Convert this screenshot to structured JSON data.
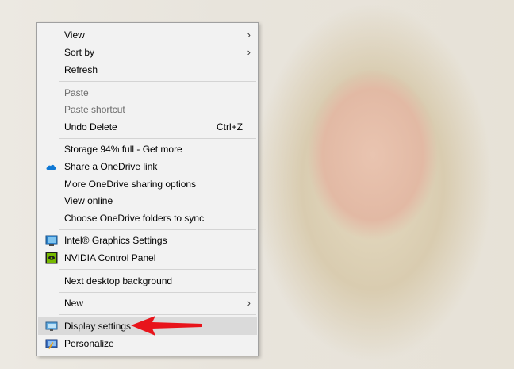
{
  "menu": {
    "view": "View",
    "sort_by": "Sort by",
    "refresh": "Refresh",
    "paste": "Paste",
    "paste_shortcut": "Paste shortcut",
    "undo_delete": "Undo Delete",
    "undo_shortcut": "Ctrl+Z",
    "storage": "Storage 94% full - Get more",
    "share_onedrive": "Share a OneDrive link",
    "more_sharing": "More OneDrive sharing options",
    "view_online": "View online",
    "choose_folders": "Choose OneDrive folders to sync",
    "intel_graphics": "Intel® Graphics Settings",
    "nvidia": "NVIDIA Control Panel",
    "next_background": "Next desktop background",
    "new": "New",
    "display_settings": "Display settings",
    "personalize": "Personalize"
  },
  "icons": {
    "onedrive": "onedrive-cloud-icon",
    "intel": "intel-graphics-icon",
    "nvidia": "nvidia-icon",
    "display": "display-icon",
    "personalize": "personalize-icon"
  },
  "colors": {
    "menu_bg": "#f2f2f2",
    "highlight": "#dadada",
    "annotation_arrow": "#e8141b",
    "onedrive_blue": "#0f78d4"
  }
}
